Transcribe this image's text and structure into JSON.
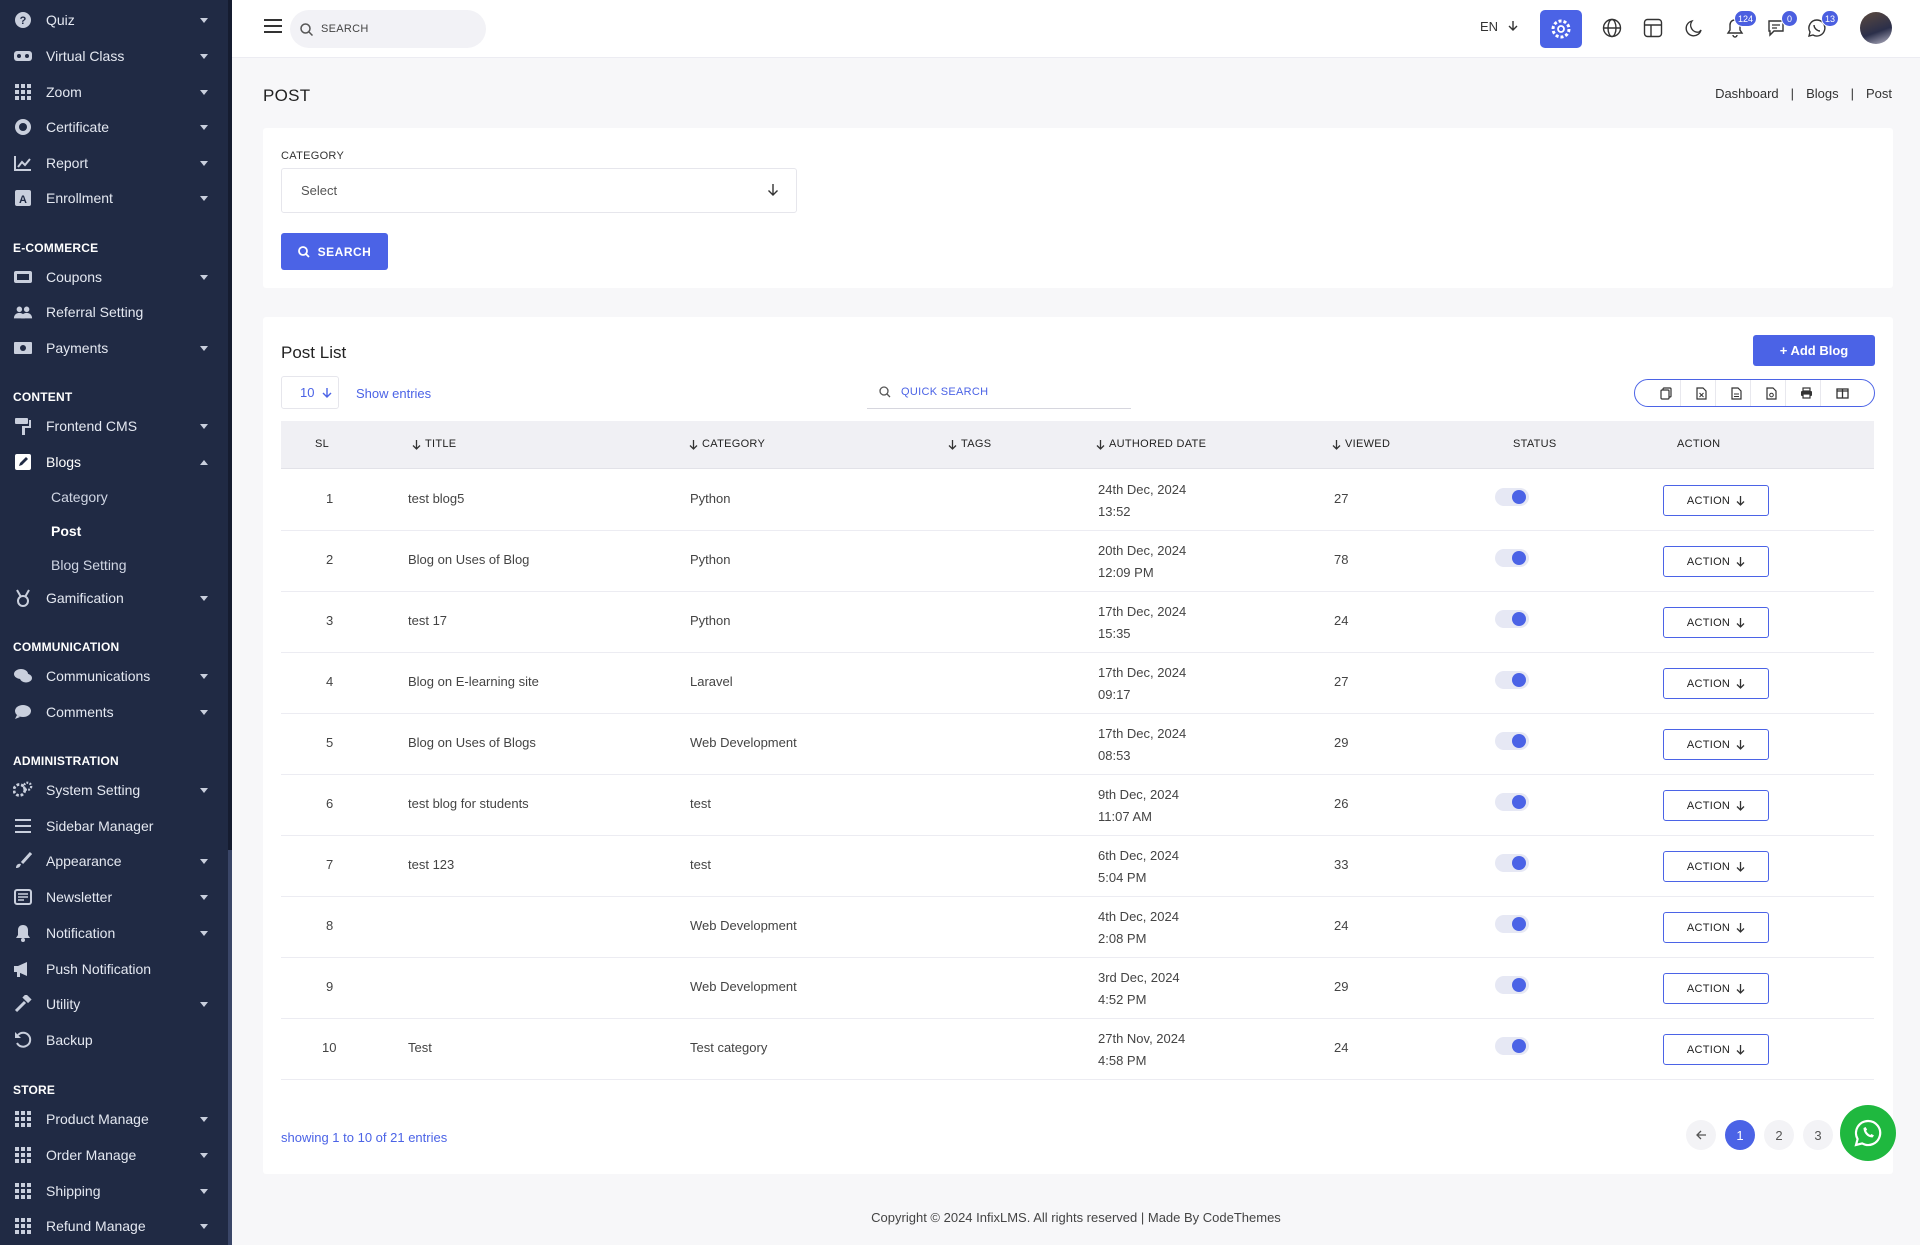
{
  "sidebar": {
    "items": [
      {
        "label": "Quiz",
        "icon": "question-circle-icon",
        "caret": true
      },
      {
        "label": "Virtual Class",
        "icon": "vr-headset-icon",
        "caret": true
      },
      {
        "label": "Zoom",
        "icon": "grid-icon",
        "caret": true
      },
      {
        "label": "Certificate",
        "icon": "badge-icon",
        "caret": true
      },
      {
        "label": "Report",
        "icon": "chart-icon",
        "caret": true
      },
      {
        "label": "Enrollment",
        "icon": "enrollment-icon",
        "caret": true
      }
    ],
    "sections": {
      "ecommerce": "E-COMMERCE",
      "content": "CONTENT",
      "communication": "COMMUNICATION",
      "administration": "ADMINISTRATION",
      "store": "STORE"
    },
    "ecommerce_items": [
      {
        "label": "Coupons",
        "caret": true
      },
      {
        "label": "Referral Setting",
        "caret": false
      },
      {
        "label": "Payments",
        "caret": true
      }
    ],
    "content_items": [
      {
        "label": "Frontend CMS",
        "caret": true
      },
      {
        "label": "Blogs",
        "caret": true,
        "expanded": true
      }
    ],
    "blog_subitems": [
      "Category",
      "Post",
      "Blog Setting"
    ],
    "gamification": "Gamification",
    "communication_items": [
      {
        "label": "Communications",
        "caret": true
      },
      {
        "label": "Comments",
        "caret": true
      }
    ],
    "administration_items": [
      {
        "label": "System Setting",
        "caret": true
      },
      {
        "label": "Sidebar Manager",
        "caret": false
      },
      {
        "label": "Appearance",
        "caret": true
      },
      {
        "label": "Newsletter",
        "caret": true
      },
      {
        "label": "Notification",
        "caret": true
      },
      {
        "label": "Push Notification",
        "caret": false
      },
      {
        "label": "Utility",
        "caret": true
      },
      {
        "label": "Backup",
        "caret": false
      }
    ],
    "store_items": [
      {
        "label": "Product Manage",
        "caret": true
      },
      {
        "label": "Order Manage",
        "caret": true
      },
      {
        "label": "Shipping",
        "caret": true
      },
      {
        "label": "Refund Manage",
        "caret": true
      }
    ]
  },
  "topbar": {
    "search_placeholder": "SEARCH",
    "language": "EN",
    "badges": {
      "notifications": "124",
      "messages": "0",
      "whatsapp": "13"
    }
  },
  "page": {
    "title": "POST",
    "breadcrumb": [
      "Dashboard",
      "Blogs",
      "Post"
    ]
  },
  "filter": {
    "category_label": "CATEGORY",
    "category_value": "Select",
    "search_button": "SEARCH"
  },
  "list": {
    "title": "Post List",
    "add_button": "+ Add Blog",
    "page_length": "10",
    "show_entries": "Show entries",
    "quick_search_placeholder": "QUICK SEARCH",
    "columns": [
      "SL",
      "TITLE",
      "CATEGORY",
      "TAGS",
      "AUTHORED DATE",
      "VIEWED",
      "STATUS",
      "ACTION"
    ],
    "rows": [
      {
        "sl": "1",
        "title": "test blog5",
        "category": "Python",
        "tags": "",
        "date": "24th Dec, 2024",
        "time": "13:52",
        "viewed": "27",
        "status": "on",
        "action": "ACTION"
      },
      {
        "sl": "2",
        "title": "Blog on Uses of Blog",
        "category": "Python",
        "tags": "",
        "date": "20th Dec, 2024",
        "time": "12:09 PM",
        "viewed": "78",
        "status": "on",
        "action": "ACTION"
      },
      {
        "sl": "3",
        "title": "test 17",
        "category": "Python",
        "tags": "",
        "date": "17th Dec, 2024",
        "time": "15:35",
        "viewed": "24",
        "status": "on",
        "action": "ACTION"
      },
      {
        "sl": "4",
        "title": "Blog on E-learning site",
        "category": "Laravel",
        "tags": "",
        "date": "17th Dec, 2024",
        "time": "09:17",
        "viewed": "27",
        "status": "on",
        "action": "ACTION"
      },
      {
        "sl": "5",
        "title": "Blog on Uses of Blogs",
        "category": "Web Development",
        "tags": "",
        "date": "17th Dec, 2024",
        "time": "08:53",
        "viewed": "29",
        "status": "on",
        "action": "ACTION"
      },
      {
        "sl": "6",
        "title": "test blog for students",
        "category": "test",
        "tags": "",
        "date": "9th Dec, 2024",
        "time": "11:07 AM",
        "viewed": "26",
        "status": "on",
        "action": "ACTION"
      },
      {
        "sl": "7",
        "title": "test 123",
        "category": "test",
        "tags": "",
        "date": "6th Dec, 2024",
        "time": "5:04 PM",
        "viewed": "33",
        "status": "on",
        "action": "ACTION"
      },
      {
        "sl": "8",
        "title": "",
        "category": "Web Development",
        "tags": "",
        "date": "4th Dec, 2024",
        "time": "2:08 PM",
        "viewed": "24",
        "status": "on",
        "action": "ACTION"
      },
      {
        "sl": "9",
        "title": "",
        "category": "Web Development",
        "tags": "",
        "date": "3rd Dec, 2024",
        "time": "4:52 PM",
        "viewed": "29",
        "status": "on",
        "action": "ACTION"
      },
      {
        "sl": "10",
        "title": "Test",
        "category": "Test category",
        "tags": "",
        "date": "27th Nov, 2024",
        "time": "4:58 PM",
        "viewed": "24",
        "status": "on",
        "action": "ACTION"
      }
    ],
    "showing_text": "showing 1 to 10 of 21 entries",
    "pages": [
      "1",
      "2",
      "3"
    ],
    "current_page": "1"
  },
  "footer": {
    "text": "Copyright © 2024 InfixLMS. All rights reserved | Made By CodeThemes"
  },
  "colors": {
    "accent": "#4b63e6",
    "sidebar_bg": "#202a44",
    "whatsapp": "#1fb83f"
  }
}
